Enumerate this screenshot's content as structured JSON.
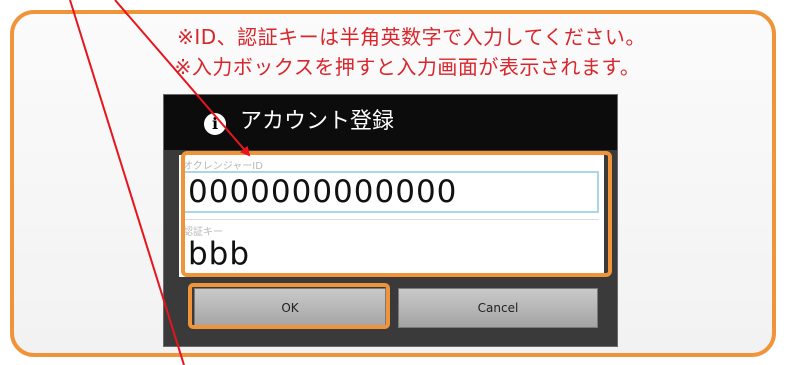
{
  "notes": {
    "line1": "※ID、認証キーは半角英数字で入力してください。",
    "line2": "※入力ボックスを押すと入力画面が表示されます。"
  },
  "dialog": {
    "title": "アカウント登録",
    "icon": "info-icon",
    "id_label": "オクレンジャーID",
    "id_value": "0000000000000",
    "key_label": "認証キー",
    "key_value": "bbb",
    "ok_label": "OK",
    "cancel_label": "Cancel"
  },
  "colors": {
    "highlight": "#f0943a",
    "note_text": "#d9262c",
    "annotation_line": "#e8141c"
  }
}
